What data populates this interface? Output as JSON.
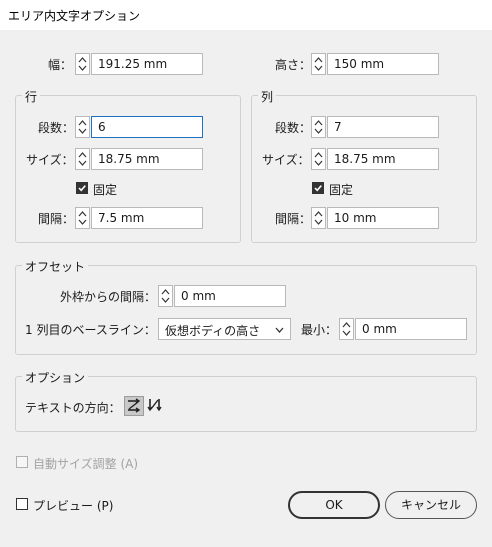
{
  "window": {
    "title": "エリア内文字オプション"
  },
  "size": {
    "width_label": "幅：",
    "width_value": "191.25 mm",
    "height_label": "高さ：",
    "height_value": "150 mm"
  },
  "rows": {
    "group_title": "行",
    "count_label": "段数：",
    "count_value": "6",
    "size_label": "サイズ：",
    "size_value": "18.75 mm",
    "fixed_label": "固定",
    "fixed_checked": true,
    "gutter_label": "間隔：",
    "gutter_value": "7.5 mm"
  },
  "columns": {
    "group_title": "列",
    "count_label": "段数：",
    "count_value": "7",
    "size_label": "サイズ：",
    "size_value": "18.75 mm",
    "fixed_label": "固定",
    "fixed_checked": true,
    "gutter_label": "間隔：",
    "gutter_value": "10 mm"
  },
  "offset": {
    "group_title": "オフセット",
    "inset_label": "外枠からの間隔：",
    "inset_value": "0 mm",
    "baseline_label": "1 列目のベースライン：",
    "baseline_selected": "仮想ボディの高さ",
    "min_label": "最小：",
    "min_value": "0 mm"
  },
  "options": {
    "group_title": "オプション",
    "direction_label": "テキストの方向：",
    "direction_active": "horizontal-flow-icon",
    "direction_other": "vertical-flow-icon"
  },
  "auto_size": {
    "label": "自動サイズ調整 (A)",
    "checked": false,
    "disabled": true
  },
  "preview": {
    "label": "プレビュー (P)",
    "checked": false
  },
  "buttons": {
    "ok": "OK",
    "cancel": "キャンセル"
  },
  "colors": {
    "focus_border": "#1f6fc5",
    "dialog_bg": "#f0f0f0"
  }
}
